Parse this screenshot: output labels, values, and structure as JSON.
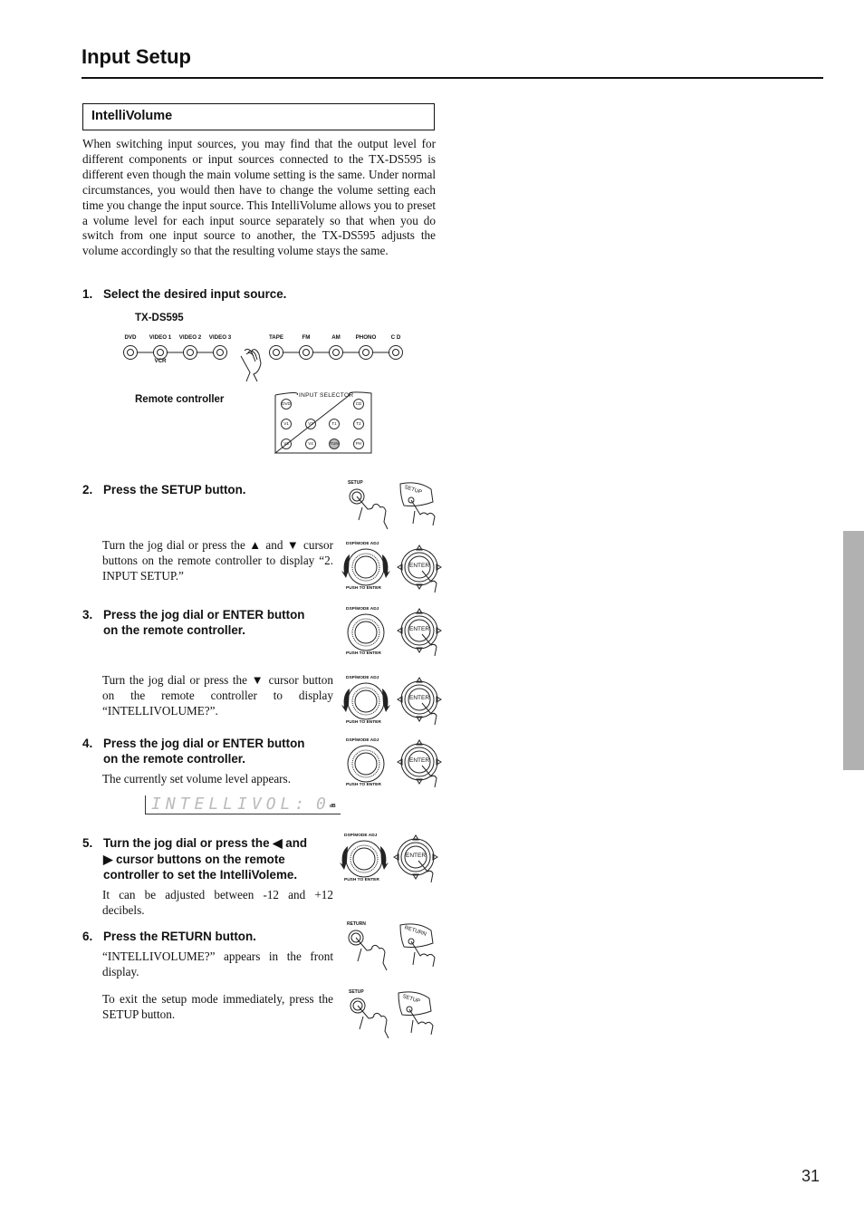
{
  "page": {
    "title": "Input Setup",
    "page_number": "31",
    "side_tab_color": "#b1b1b1"
  },
  "section": {
    "heading": "IntelliVolume",
    "intro": "When switching input sources, you may find that the output level for different components or input sources connected to the TX-DS595 is different even though the main volume setting is the same. Under normal circumstances, you would then have to change the volume setting each time you change the input source. This IntelliVolume allows you to preset a volume level for each input source separately so that when you do switch from one input source to another, the TX-DS595 adjusts the volume accordingly so that the resulting volume stays the same."
  },
  "steps": [
    {
      "num": "1.",
      "text": "Select the desired input source."
    },
    {
      "num": "2.",
      "text": "Press the SETUP button.",
      "note": "Turn the jog dial or press the ▲ and ▼ cursor buttons on the remote controller to display “2. INPUT SETUP.”"
    },
    {
      "num": "3.",
      "text_line1": "Press the jog dial or ENTER button",
      "text_line2": "on the remote controller.",
      "note": "Turn the jog dial or press the ▼ cursor button on the remote controller to display “INTELLIVOLUME?”."
    },
    {
      "num": "4.",
      "text_line1": "Press the jog dial or ENTER button",
      "text_line2": "on the remote controller.",
      "note": "The currently set volume level appears."
    },
    {
      "num": "5.",
      "text_line1": "Turn the jog dial or press the ◀ and",
      "text_line2": "▶ cursor buttons on the remote",
      "text_line3": "controller to set the IntelliVoleme.",
      "note": "It can be adjusted between -12 and +12 decibels."
    },
    {
      "num": "6.",
      "text": "Press the RETURN button.",
      "note": "“INTELLIVOLUME?” appears in the front display.",
      "note2": "To exit the setup mode immediately, press the SETUP button."
    }
  ],
  "front_panel": {
    "model": "TX-DS595",
    "inputs": [
      "DVD",
      "VIDEO 1",
      "VIDEO 2",
      "VIDEO 3",
      "TAPE",
      "FM",
      "AM",
      "PHONO",
      "C D"
    ],
    "sub_label": "VCR"
  },
  "remote": {
    "label": "Remote controller",
    "panel_title": "INPUT SELECTOR",
    "buttons_row1": [
      "DVD",
      "CD"
    ],
    "buttons_row2": [
      "V1",
      "V2",
      "T1",
      "T2"
    ],
    "buttons_row3": [
      "V3",
      "V4",
      "TUN",
      "PH"
    ]
  },
  "illustrations": {
    "setup_label": "SETUP",
    "return_label": "RETURN",
    "dial_top_label": "DSP/MODE ADJ",
    "dial_bottom_label": "PUSH TO ENTER",
    "enter_label": "ENTER"
  },
  "display": {
    "text": "INTELLIVOL:",
    "value": "0",
    "unit": "dB"
  }
}
